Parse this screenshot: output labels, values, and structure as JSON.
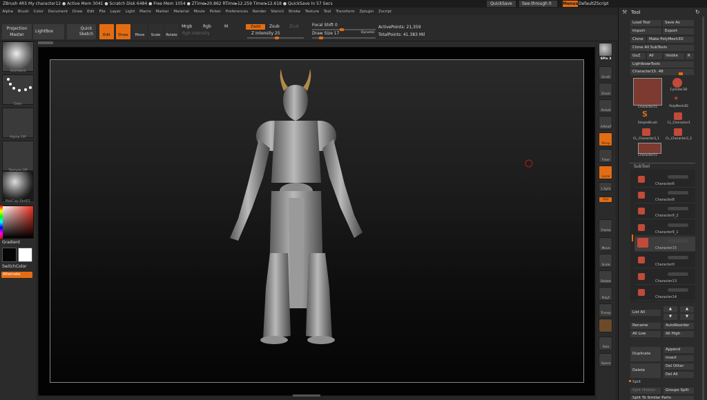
{
  "titlebar": {
    "text": "ZBrush 4R5    My character12    ● Active Mem 3041  ● Scratch Disk 6484  ● Free Mem 1054  ● ZTime▸20.862  RTime▸12.259  Timer▸12.618  ● QuickSave In 57 Secs"
  },
  "top_right": {
    "quicksave": "QuickSave",
    "seethrough": "See-through  0",
    "menus": "Menus",
    "default_zscript": "DefaultZScript"
  },
  "menubar": [
    "Alpha",
    "Brush",
    "Color",
    "Document",
    "Draw",
    "Edit",
    "File",
    "Layer",
    "Light",
    "Macro",
    "Marker",
    "Material",
    "Movie",
    "Picker",
    "Preferences",
    "Render",
    "Stencil",
    "Stroke",
    "Texture",
    "Tool",
    "Transform",
    "Zplugin",
    "Zscript"
  ],
  "toolbar": {
    "projection_master": "Projection Master",
    "lightbox": "LightBox",
    "quick_sketch": "Quick Sketch",
    "edit": "Edit",
    "draw": "Draw",
    "move": "Move",
    "scale": "Scale",
    "rotate": "Rotate",
    "mrgb": "Mrgb",
    "rgb": "Rgb",
    "m": "M",
    "rgb_intensity": "Rgb  Intensity",
    "zadd": "Zadd",
    "zsub": "Zsub",
    "zcut": "Zcut",
    "z_intensity": "Z Intensity 25",
    "focal_shift": "Focal Shift 0",
    "draw_size": "Draw Size 17",
    "dynamic": "Dynamic",
    "active_points": "ActivePoints: 21,359",
    "total_points": "TotalPoints: 41.383 Mil"
  },
  "leftbar": {
    "brush": "Standard",
    "stroke": "Dots",
    "alpha": "Alpha Off",
    "texture": "Texture Off",
    "material": "MatCap Red01",
    "gradient": "Gradient",
    "switch_color": "SwitchColor",
    "alternate": "Alternate"
  },
  "rshelf": [
    "BPR",
    "SPix 3",
    "Scroll",
    "Zoom",
    "Actual",
    "AAHalf",
    "Persp",
    "Floor",
    "Local",
    "L.Sym",
    "Xyz",
    "Frame",
    "Move",
    "Scale",
    "Rotate",
    "PolyF",
    "Transp",
    "Ghost",
    "Solo",
    "Xpose"
  ],
  "rpanel": {
    "tool_title": "Tool",
    "load_tool": "Load Tool",
    "save_as": "Save As",
    "import": "Import",
    "export": "Export",
    "clone": "Clone",
    "make_polymesh": "Make PolyMesh3D",
    "clone_all": "Clone All SubTools",
    "goz": "GoZ",
    "all": "All",
    "visible": "Visible",
    "r": "R",
    "lightbox_tools": "Lightbox▸Tools",
    "current_tool": "Character15. 48",
    "tools": [
      "Character15",
      "Cylinder3D",
      "PolyMesh3D",
      "SimpleBrush",
      "CL_Character3",
      "CL_Character3_1",
      "CL_Character2_2",
      "Character15"
    ],
    "subtool_title": "SubTool",
    "subtools": [
      "Character6",
      "Character8",
      "Character9_2",
      "Character9_1",
      "Character15",
      "Character0",
      "Character13",
      "Character14"
    ],
    "list_all": "List All",
    "rename": "Rename",
    "autoreorder": "AutoReorder",
    "all_low": "All Low",
    "all_high": "All High",
    "duplicate": "Duplicate",
    "append": "Append",
    "insert": "Insert",
    "delete": "Delete",
    "del_other": "Del Other",
    "del_all": "Del All",
    "split": "Split",
    "split_hidden": "Split Hidden",
    "groups_split": "Groups Split",
    "split_similar": "Split To Similar Parts"
  },
  "colors": {
    "accent": "#e46d13",
    "panel": "#2b2b2b",
    "button": "#3a3a3a"
  }
}
